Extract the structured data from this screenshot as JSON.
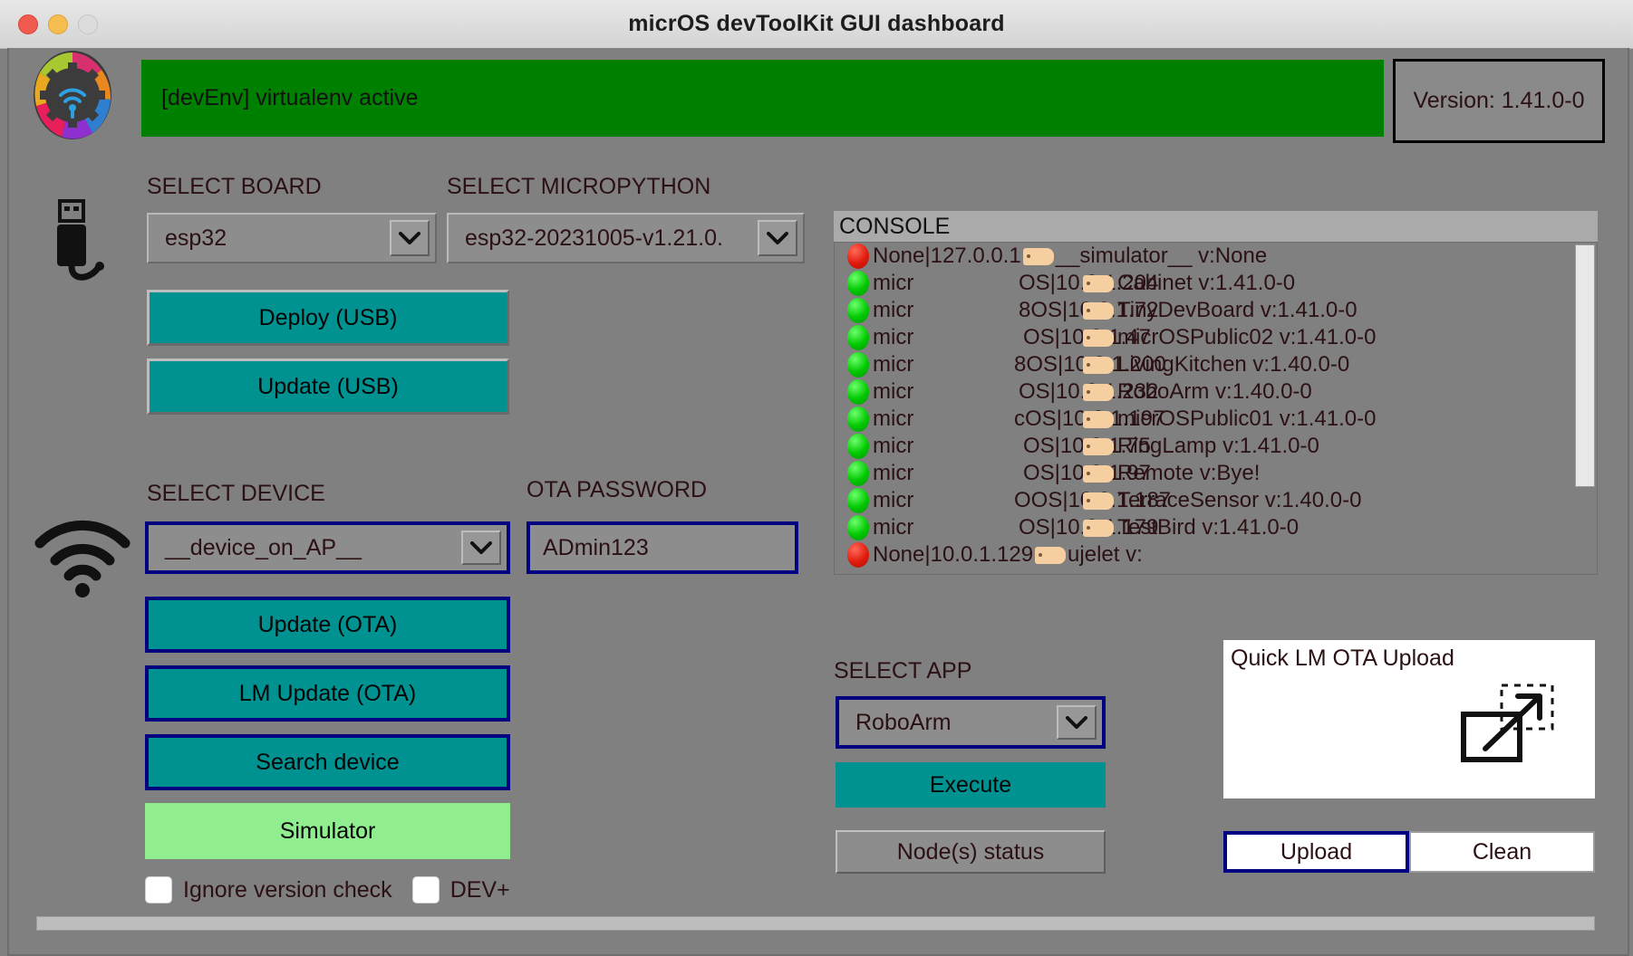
{
  "window": {
    "title": "micrOS devToolKit GUI dashboard",
    "traffic_lights": [
      "close",
      "minimize",
      "zoom"
    ]
  },
  "status": {
    "message": "[devEnv] virtualenv active",
    "color": "#008000",
    "version_label": "Version: 1.41.0-0"
  },
  "board_section": {
    "select_board_label": "SELECT BOARD",
    "board_value": "esp32",
    "select_micropython_label": "SELECT MICROPYTHON",
    "micropython_value": "esp32-20231005-v1.21.0.",
    "deploy_usb_label": "Deploy (USB)",
    "update_usb_label": "Update (USB)"
  },
  "device_section": {
    "select_device_label": "SELECT DEVICE",
    "device_value": "__device_on_AP__",
    "ota_password_label": "OTA PASSWORD",
    "ota_password_value": "ADmin123",
    "update_ota_label": "Update (OTA)",
    "lm_update_ota_label": "LM Update (OTA)",
    "search_device_label": "Search device",
    "simulator_label": "Simulator",
    "ignore_version_check_label": "Ignore version check",
    "dev_plus_label": "DEV+"
  },
  "app_section": {
    "select_app_label": "SELECT APP",
    "app_value": "RoboArm",
    "execute_label": "Execute",
    "nodes_status_label": "Node(s) status"
  },
  "quick_lm": {
    "title": "Quick LM OTA Upload",
    "icon": "drag-drop-upload-icon",
    "upload_label": "Upload",
    "clean_label": "Clean"
  },
  "console": {
    "header": "CONSOLE",
    "lines": [
      {
        "status": "red",
        "prefix": "None|127.0.0.1",
        "middle": "",
        "name": "__simulator__ v:None"
      },
      {
        "status": "green",
        "prefix": "micr",
        "middle": "OS|10.0.1.204",
        "name": "Cabinet v:1.41.0-0"
      },
      {
        "status": "green",
        "prefix": "micr",
        "middle": "8OS|10.0.1.72",
        "name": "TinyDevBoard v:1.41.0-0"
      },
      {
        "status": "green",
        "prefix": "micr",
        "middle": "OS|10.0.1.47",
        "name": "micrOSPublic02 v:1.41.0-0"
      },
      {
        "status": "green",
        "prefix": "micr",
        "middle": "8OS|10.0.1.200",
        "name": "LivingKitchen v:1.40.0-0"
      },
      {
        "status": "green",
        "prefix": "micr",
        "middle": "OS|10.0.1.232",
        "name": "RoboArm v:1.40.0-0"
      },
      {
        "status": "green",
        "prefix": "micr",
        "middle": "cOS|10.0.1.197",
        "name": "micrOSPublic01 v:1.41.0-0"
      },
      {
        "status": "green",
        "prefix": "micr",
        "middle": "OS|10.0.1.75",
        "name": "RingLamp v:1.41.0-0"
      },
      {
        "status": "green",
        "prefix": "micr",
        "middle": "OS|10.0.1.97",
        "name": "Remote v:Bye!"
      },
      {
        "status": "green",
        "prefix": "micr",
        "middle": "OOS|10.0.1.187",
        "name": "TerraceSensor v:1.40.0-0"
      },
      {
        "status": "green",
        "prefix": "micr",
        "middle": "OS|10.0.1.179",
        "name": "TestBird v:1.41.0-0"
      },
      {
        "status": "red",
        "prefix": "None|10.0.1.129",
        "middle": "",
        "name": "ujelet v:"
      }
    ]
  },
  "colors": {
    "background": "#808080",
    "teal_button": "#009191",
    "green_status": "#008000",
    "focus_border": "#000080",
    "simulator_green": "#90ee90"
  }
}
